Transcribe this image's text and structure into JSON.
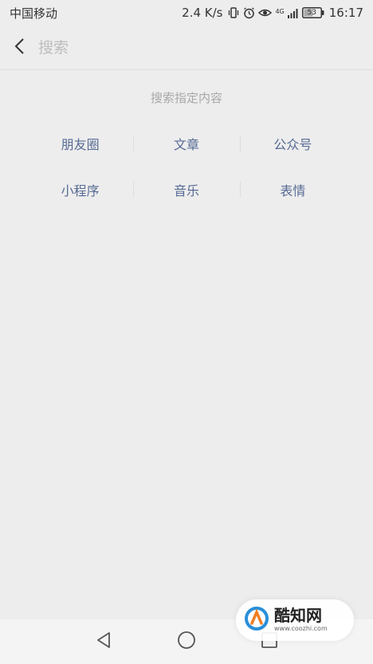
{
  "status_bar": {
    "carrier": "中国移动",
    "network_speed": "2.4 K/s",
    "network_type": "4G",
    "battery_level": "53",
    "time": "16:17",
    "icons": [
      "vibrate-icon",
      "alarm-icon",
      "eye-icon",
      "signal-icon",
      "battery-icon"
    ]
  },
  "header": {
    "search_placeholder": "搜索",
    "back_icon": "chevron-left-icon"
  },
  "content": {
    "title": "搜索指定内容",
    "categories": [
      [
        "朋友圈",
        "文章",
        "公众号"
      ],
      [
        "小程序",
        "音乐",
        "表情"
      ]
    ],
    "accent_color": "#576b95"
  },
  "nav_bar": {
    "icons": [
      "back-triangle-icon",
      "home-circle-icon",
      "recents-square-icon"
    ]
  },
  "watermark": {
    "name": "酷知网",
    "url": "www.coozhi.com"
  }
}
